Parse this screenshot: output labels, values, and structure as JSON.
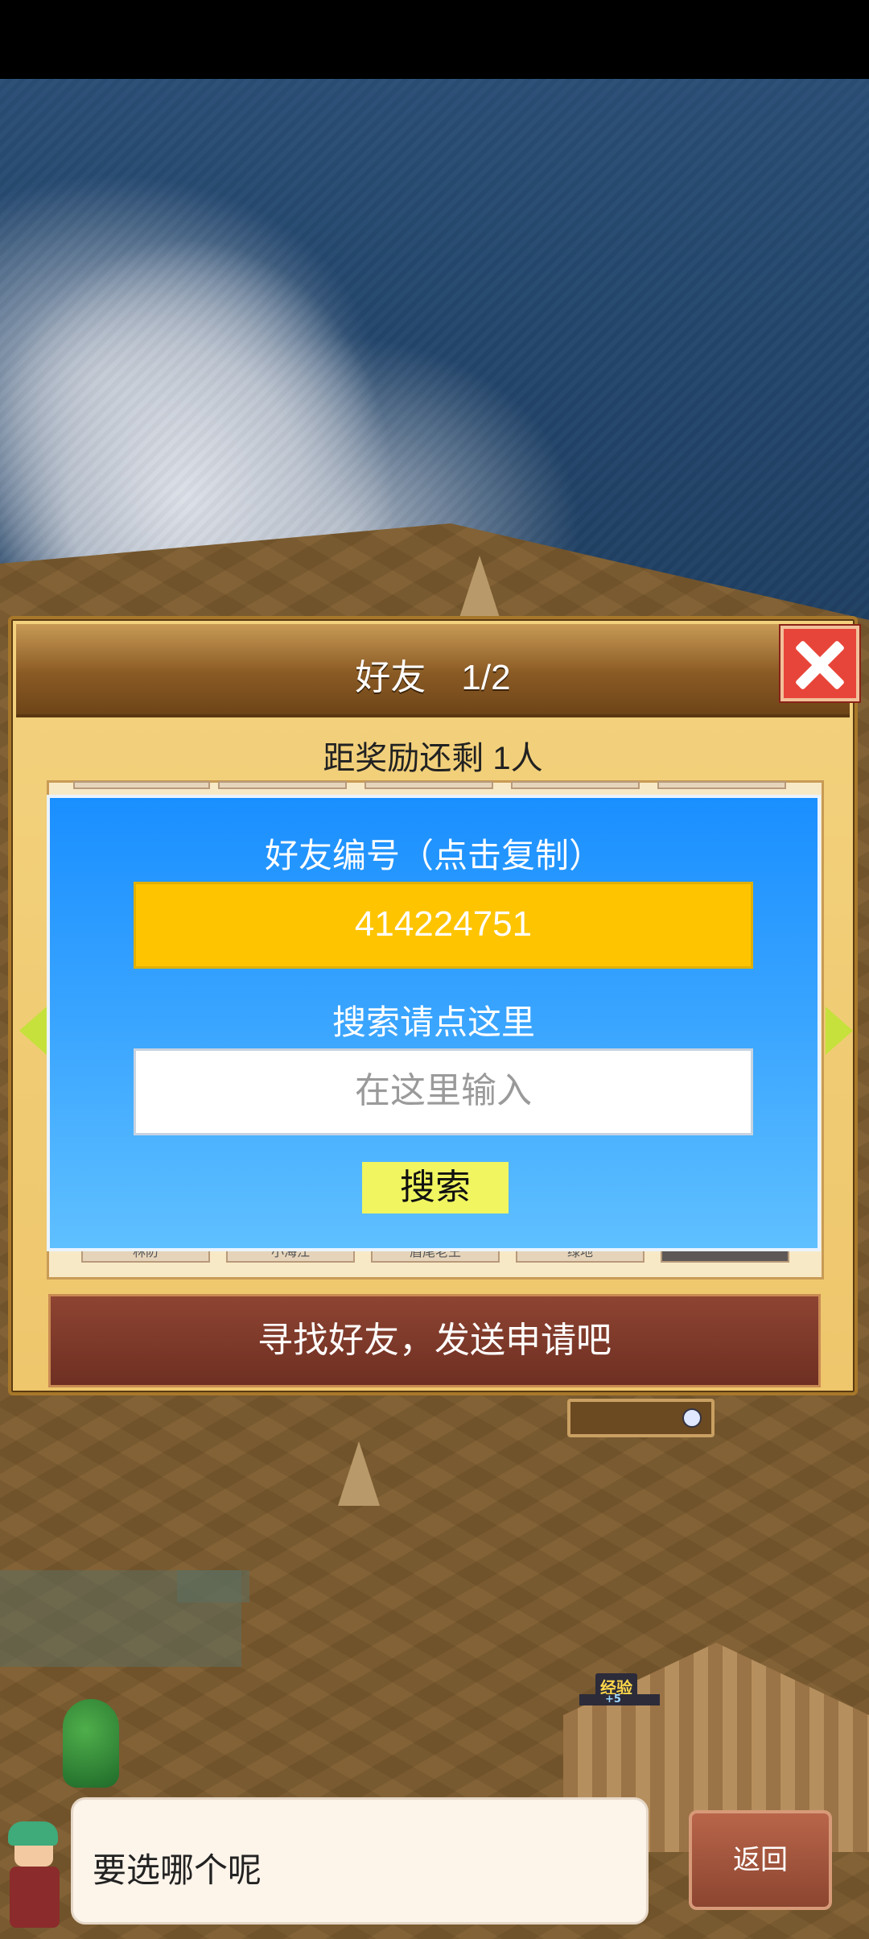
{
  "dialog": {
    "title": "好友　1/2",
    "reward_text": "距奖励还剩 1人",
    "slots_bottom": [
      "林防",
      "小海江",
      "眉尾老王",
      "绿地",
      ""
    ],
    "friend_id_label": "好友编号（点击复制）",
    "friend_id": "414224751",
    "search_label": "搜索请点这里",
    "search_placeholder": "在这里输入",
    "search_button": "搜索",
    "find_friends_button": "寻找好友，发送申请吧",
    "close_icon": "close-x-icon"
  },
  "scene": {
    "exp_label": "经验",
    "exp_gain": "+5"
  },
  "bottom": {
    "speech_text": "要选哪个呢",
    "back_button": "返回"
  },
  "colors": {
    "panel_blue": "#1a8fff",
    "id_box": "#ffc400",
    "search_button": "#f0f560",
    "close_button": "#e8453a",
    "find_bar": "#7a3626"
  }
}
